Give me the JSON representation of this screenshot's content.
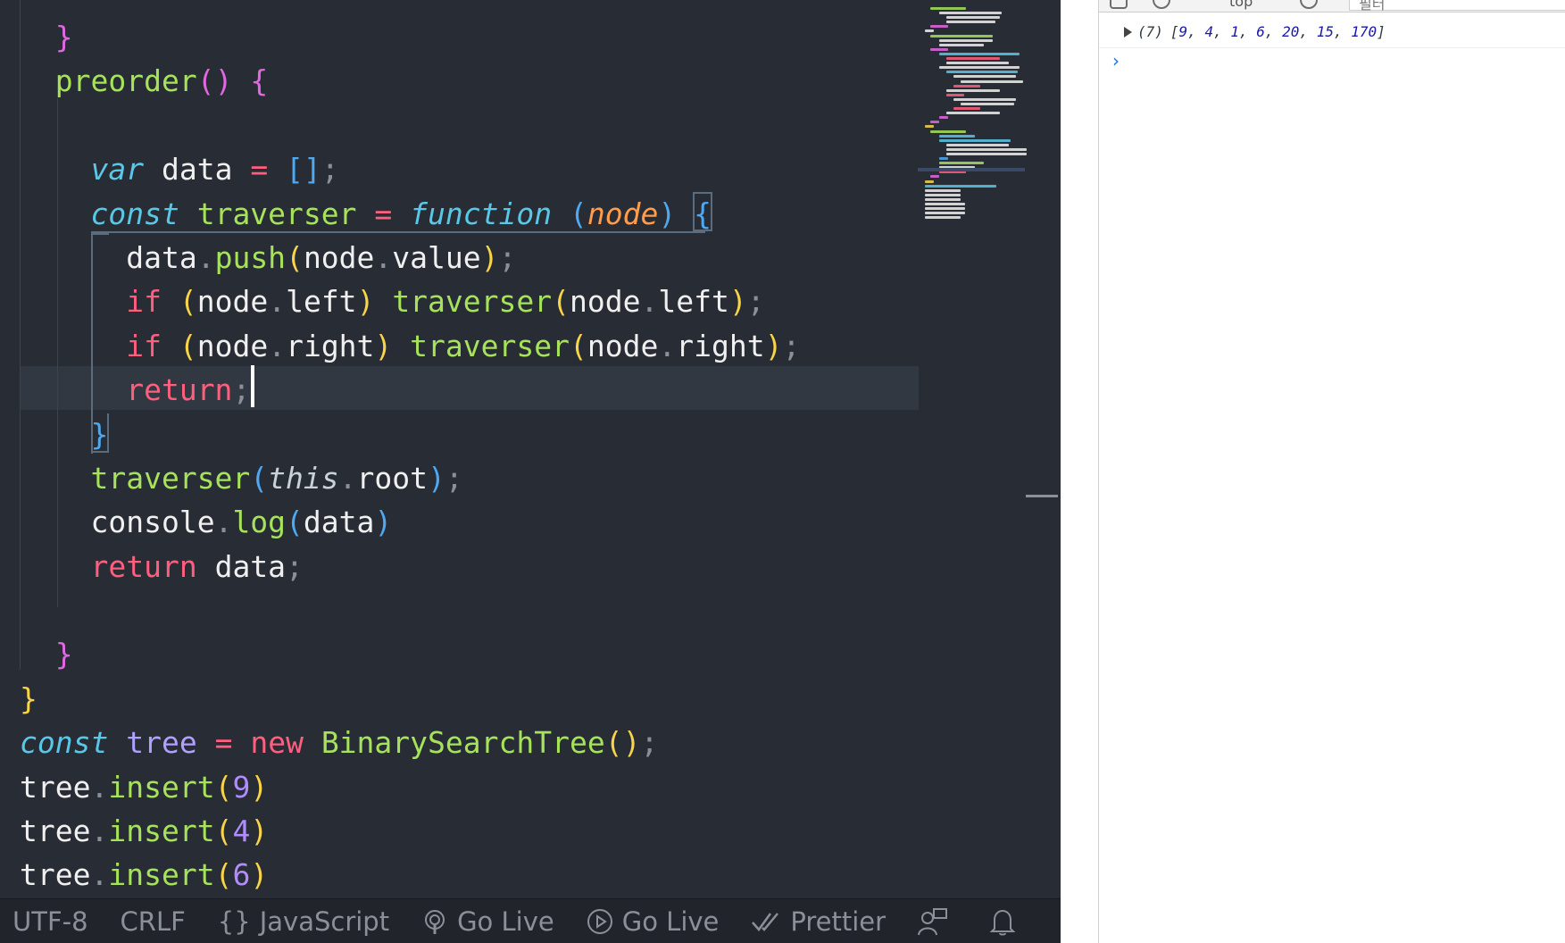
{
  "editor": {
    "code_lines": [
      [
        {
          "t": "  ",
          "c": "plain"
        },
        {
          "t": "}",
          "c": "b2"
        }
      ],
      [
        {
          "t": "  ",
          "c": "plain"
        },
        {
          "t": "preorder",
          "c": "fn"
        },
        {
          "t": "()",
          "c": "b2"
        },
        {
          "t": " ",
          "c": "plain"
        },
        {
          "t": "{",
          "c": "b2"
        }
      ],
      [
        {
          "t": "",
          "c": "plain"
        }
      ],
      [
        {
          "t": "    ",
          "c": "plain"
        },
        {
          "t": "var",
          "c": "kw-i"
        },
        {
          "t": " data ",
          "c": "plain"
        },
        {
          "t": "=",
          "c": "op"
        },
        {
          "t": " ",
          "c": "plain"
        },
        {
          "t": "[]",
          "c": "b3"
        },
        {
          "t": ";",
          "c": "punc"
        }
      ],
      [
        {
          "t": "    ",
          "c": "plain"
        },
        {
          "t": "const",
          "c": "kw-i"
        },
        {
          "t": " ",
          "c": "plain"
        },
        {
          "t": "traverser",
          "c": "fn"
        },
        {
          "t": " ",
          "c": "plain"
        },
        {
          "t": "=",
          "c": "op"
        },
        {
          "t": " ",
          "c": "plain"
        },
        {
          "t": "function",
          "c": "kw-i"
        },
        {
          "t": " ",
          "c": "plain"
        },
        {
          "t": "(",
          "c": "b3"
        },
        {
          "t": "node",
          "c": "param"
        },
        {
          "t": ")",
          "c": "b3"
        },
        {
          "t": " ",
          "c": "plain"
        },
        {
          "t": "{",
          "c": "b3"
        }
      ],
      [
        {
          "t": "      ",
          "c": "plain"
        },
        {
          "t": "data",
          "c": "plain"
        },
        {
          "t": ".",
          "c": "punc"
        },
        {
          "t": "push",
          "c": "fn"
        },
        {
          "t": "(",
          "c": "b1"
        },
        {
          "t": "node",
          "c": "plain"
        },
        {
          "t": ".",
          "c": "punc"
        },
        {
          "t": "value",
          "c": "plain"
        },
        {
          "t": ")",
          "c": "b1"
        },
        {
          "t": ";",
          "c": "punc"
        }
      ],
      [
        {
          "t": "      ",
          "c": "plain"
        },
        {
          "t": "if",
          "c": "kw-r"
        },
        {
          "t": " ",
          "c": "plain"
        },
        {
          "t": "(",
          "c": "b1"
        },
        {
          "t": "node",
          "c": "plain"
        },
        {
          "t": ".",
          "c": "punc"
        },
        {
          "t": "left",
          "c": "plain"
        },
        {
          "t": ")",
          "c": "b1"
        },
        {
          "t": " ",
          "c": "plain"
        },
        {
          "t": "traverser",
          "c": "fn"
        },
        {
          "t": "(",
          "c": "b1"
        },
        {
          "t": "node",
          "c": "plain"
        },
        {
          "t": ".",
          "c": "punc"
        },
        {
          "t": "left",
          "c": "plain"
        },
        {
          "t": ")",
          "c": "b1"
        },
        {
          "t": ";",
          "c": "punc"
        }
      ],
      [
        {
          "t": "      ",
          "c": "plain"
        },
        {
          "t": "if",
          "c": "kw-r"
        },
        {
          "t": " ",
          "c": "plain"
        },
        {
          "t": "(",
          "c": "b1"
        },
        {
          "t": "node",
          "c": "plain"
        },
        {
          "t": ".",
          "c": "punc"
        },
        {
          "t": "right",
          "c": "plain"
        },
        {
          "t": ")",
          "c": "b1"
        },
        {
          "t": " ",
          "c": "plain"
        },
        {
          "t": "traverser",
          "c": "fn"
        },
        {
          "t": "(",
          "c": "b1"
        },
        {
          "t": "node",
          "c": "plain"
        },
        {
          "t": ".",
          "c": "punc"
        },
        {
          "t": "right",
          "c": "plain"
        },
        {
          "t": ")",
          "c": "b1"
        },
        {
          "t": ";",
          "c": "punc"
        }
      ],
      [
        {
          "t": "      ",
          "c": "plain"
        },
        {
          "t": "return",
          "c": "kw-r"
        },
        {
          "t": ";",
          "c": "punc"
        }
      ],
      [
        {
          "t": "    ",
          "c": "plain"
        },
        {
          "t": "}",
          "c": "b3"
        }
      ],
      [
        {
          "t": "    ",
          "c": "plain"
        },
        {
          "t": "traverser",
          "c": "fn"
        },
        {
          "t": "(",
          "c": "b3"
        },
        {
          "t": "this",
          "c": "this"
        },
        {
          "t": ".",
          "c": "punc"
        },
        {
          "t": "root",
          "c": "plain"
        },
        {
          "t": ")",
          "c": "b3"
        },
        {
          "t": ";",
          "c": "punc"
        }
      ],
      [
        {
          "t": "    ",
          "c": "plain"
        },
        {
          "t": "console",
          "c": "plain"
        },
        {
          "t": ".",
          "c": "punc"
        },
        {
          "t": "log",
          "c": "fn"
        },
        {
          "t": "(",
          "c": "b3"
        },
        {
          "t": "data",
          "c": "plain"
        },
        {
          "t": ")",
          "c": "b3"
        }
      ],
      [
        {
          "t": "    ",
          "c": "plain"
        },
        {
          "t": "return",
          "c": "kw-r"
        },
        {
          "t": " data",
          "c": "plain"
        },
        {
          "t": ";",
          "c": "punc"
        }
      ],
      [
        {
          "t": "",
          "c": "plain"
        }
      ],
      [
        {
          "t": "  ",
          "c": "plain"
        },
        {
          "t": "}",
          "c": "b2"
        }
      ],
      [
        {
          "t": "}",
          "c": "b1"
        }
      ],
      [
        {
          "t": "const",
          "c": "kw-i"
        },
        {
          "t": " ",
          "c": "plain"
        },
        {
          "t": "tree",
          "c": "var-p"
        },
        {
          "t": " ",
          "c": "plain"
        },
        {
          "t": "=",
          "c": "op"
        },
        {
          "t": " ",
          "c": "plain"
        },
        {
          "t": "new",
          "c": "kw-r"
        },
        {
          "t": " ",
          "c": "plain"
        },
        {
          "t": "BinarySearchTree",
          "c": "fn"
        },
        {
          "t": "()",
          "c": "b1"
        },
        {
          "t": ";",
          "c": "punc"
        }
      ],
      [
        {
          "t": "tree",
          "c": "plain"
        },
        {
          "t": ".",
          "c": "punc"
        },
        {
          "t": "insert",
          "c": "fn"
        },
        {
          "t": "(",
          "c": "b1"
        },
        {
          "t": "9",
          "c": "num"
        },
        {
          "t": ")",
          "c": "b1"
        }
      ],
      [
        {
          "t": "tree",
          "c": "plain"
        },
        {
          "t": ".",
          "c": "punc"
        },
        {
          "t": "insert",
          "c": "fn"
        },
        {
          "t": "(",
          "c": "b1"
        },
        {
          "t": "4",
          "c": "num"
        },
        {
          "t": ")",
          "c": "b1"
        }
      ],
      [
        {
          "t": "tree",
          "c": "plain"
        },
        {
          "t": ".",
          "c": "punc"
        },
        {
          "t": "insert",
          "c": "fn"
        },
        {
          "t": "(",
          "c": "b1"
        },
        {
          "t": "6",
          "c": "num"
        },
        {
          "t": ")",
          "c": "b1"
        }
      ]
    ]
  },
  "statusbar": {
    "encoding": "UTF-8",
    "line_ending": "CRLF",
    "language_icon": "{}",
    "language": "JavaScript",
    "go_live_1": "Go Live",
    "go_live_2": "Go Live",
    "prettier": "Prettier",
    "icons": {
      "broadcast": "broadcast-icon",
      "play": "play-circle-icon",
      "check": "double-check-icon",
      "feedback": "feedback-person-icon",
      "bell": "bell-icon"
    }
  },
  "devtools": {
    "context": "top",
    "filter_placeholder": "필터",
    "console_message": {
      "length_label": "(7)",
      "values": [
        9,
        4,
        1,
        6,
        20,
        15,
        170
      ],
      "text": "[9, 4, 1, 6, 20, 15, 170]"
    },
    "prompt_symbol": "›"
  },
  "colors": {
    "editor_bg": "#282c34",
    "statusbar_bg": "#21252b",
    "console_number": "#1a1aa6",
    "prompt": "#1a73e8"
  }
}
